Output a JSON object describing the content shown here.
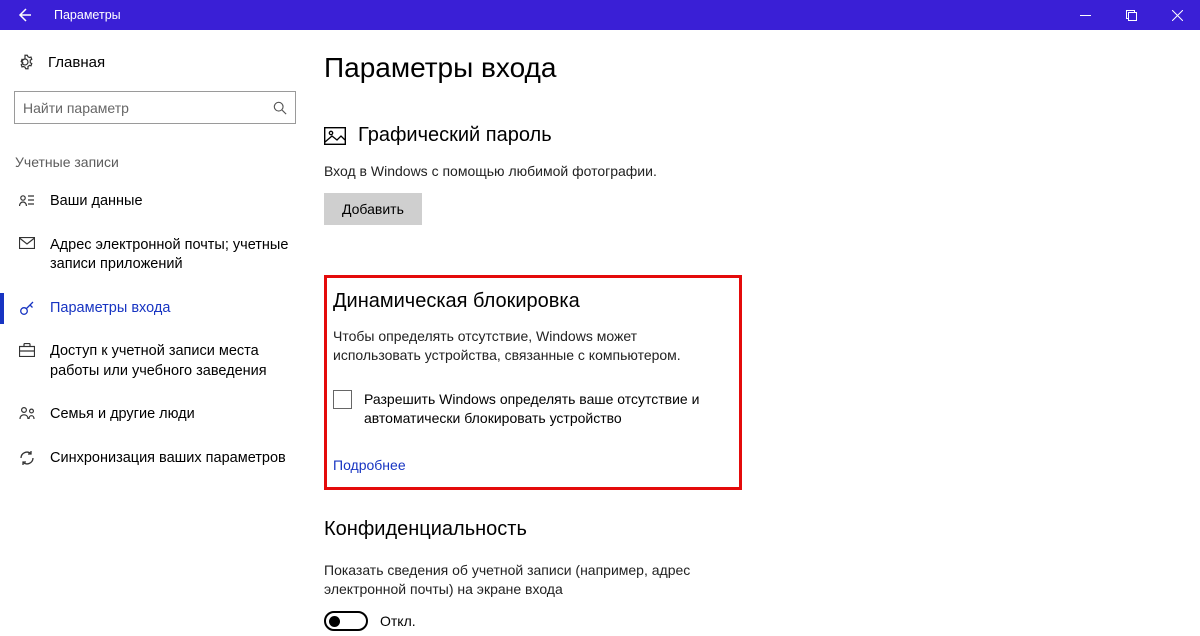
{
  "titlebar": {
    "title": "Параметры"
  },
  "sidebar": {
    "home": "Главная",
    "search_placeholder": "Найти параметр",
    "group": "Учетные записи",
    "items": [
      {
        "label": "Ваши данные"
      },
      {
        "label": "Адрес электронной почты; учетные записи приложений"
      },
      {
        "label": "Параметры входа"
      },
      {
        "label": "Доступ к учетной записи места работы или учебного заведения"
      },
      {
        "label": "Семья и другие люди"
      },
      {
        "label": "Синхронизация ваших параметров"
      }
    ]
  },
  "page": {
    "title": "Параметры входа",
    "picture_password": {
      "heading": "Графический пароль",
      "desc": "Вход в Windows с помощью любимой фотографии.",
      "add_button": "Добавить"
    },
    "dynamic_lock": {
      "heading": "Динамическая блокировка",
      "desc": "Чтобы определять отсутствие, Windows может использовать устройства, связанные с компьютером.",
      "checkbox_label": "Разрешить Windows определять ваше отсутствие и автоматически блокировать устройство",
      "more_link": "Подробнее"
    },
    "privacy": {
      "heading": "Конфиденциальность",
      "desc": "Показать сведения об учетной записи (например, адрес электронной почты) на экране входа",
      "toggle_state": "Откл."
    }
  }
}
